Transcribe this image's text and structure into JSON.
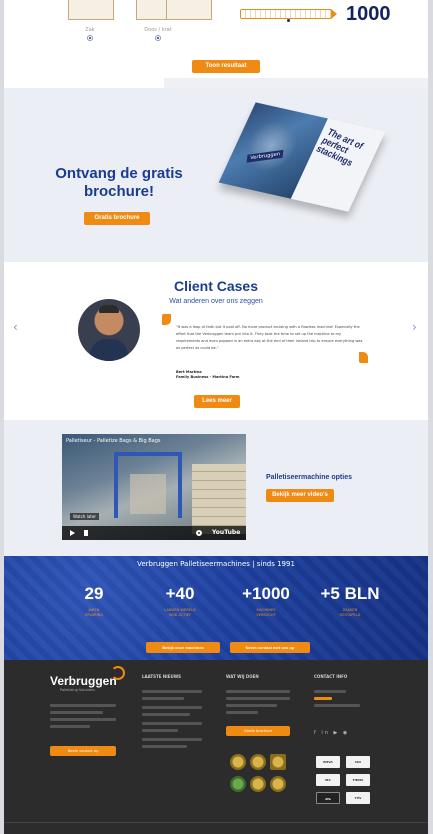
{
  "selector": {
    "options": [
      {
        "label": "Zak"
      },
      {
        "label": "Doos / krat"
      }
    ],
    "quantity": "1000",
    "show_results_label": "Toon resultaat"
  },
  "brochure": {
    "title": "Ontvang de gratis brochure!",
    "button_label": "Gratis brochure",
    "book_title": "The art of perfect stackings",
    "book_brand": "Verbruggen"
  },
  "cases": {
    "title": "Client Cases",
    "subtitle": "Wat anderen over ons zeggen",
    "quote": "\"It was a leap of faith but it paid off. No more product bruising with a flawless machine! Especially the effort that the Verbruggen team put into it. They took the time to set up the machine to my requirements and even popped in an extra day at the end of their ireland trip to ensure everything was as perfect as could be.\"",
    "author_name": "Bert Martina",
    "author_company": "Family Business - Martina Farm",
    "read_more_label": "Lees meer",
    "nav_prev": "‹",
    "nav_next": "›"
  },
  "video": {
    "video_title": "Palletiseur - Palletize Bags & Big Bags",
    "watch_later": "Watch later",
    "platform": "YouTube",
    "options_title": "Palletiseermachine opties",
    "more_videos_label": "Bekijk meer video's"
  },
  "stats": {
    "title": "Verbruggen Palletiseermachines | sinds 1991",
    "items": [
      {
        "value": "29",
        "label": "JAREN\nERVARING"
      },
      {
        "value": "+40",
        "label": "LANDEN WERELD\nWIJD ACTIEF"
      },
      {
        "value": "+1000",
        "label": "MACHINES\nVERKOCHT"
      },
      {
        "value": "+5 BLN",
        "label": "ZAKKEN\nGESTAPELD"
      }
    ],
    "button1_label": "Bekijk onze machines",
    "button2_label": "Neem contact met ons op"
  },
  "footer": {
    "logo": "Verbruggen",
    "tagline": "Palletizing Solutions",
    "col1_title": "LAATSTE NIEUWS",
    "col2_title": "WAT WIJ DOEN",
    "col3_title": "CONTACT INFO",
    "social": "f in ▶ ◉",
    "cta_label": "Neem contact op",
    "brochure_label": "Gratis brochure",
    "certs": [
      "EMVA",
      "ISO",
      "IBC",
      "FIRMA",
      "dfa",
      "TÜV"
    ]
  }
}
